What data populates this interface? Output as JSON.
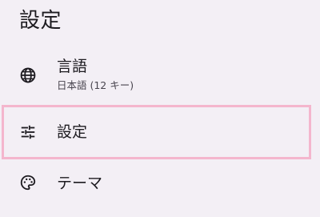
{
  "header": {
    "title": "設定"
  },
  "menu": {
    "language": {
      "label": "言語",
      "subtitle": "日本語 (12 キー)",
      "icon": "globe-icon"
    },
    "settings": {
      "label": "設定",
      "icon": "tune-sliders-icon",
      "highlight_color": "#f4b6cd"
    },
    "theme": {
      "label": "テーマ",
      "icon": "palette-icon"
    }
  },
  "colors": {
    "background": "#f3eff5",
    "text": "#1d1b20",
    "secondary_text": "#49454f"
  }
}
